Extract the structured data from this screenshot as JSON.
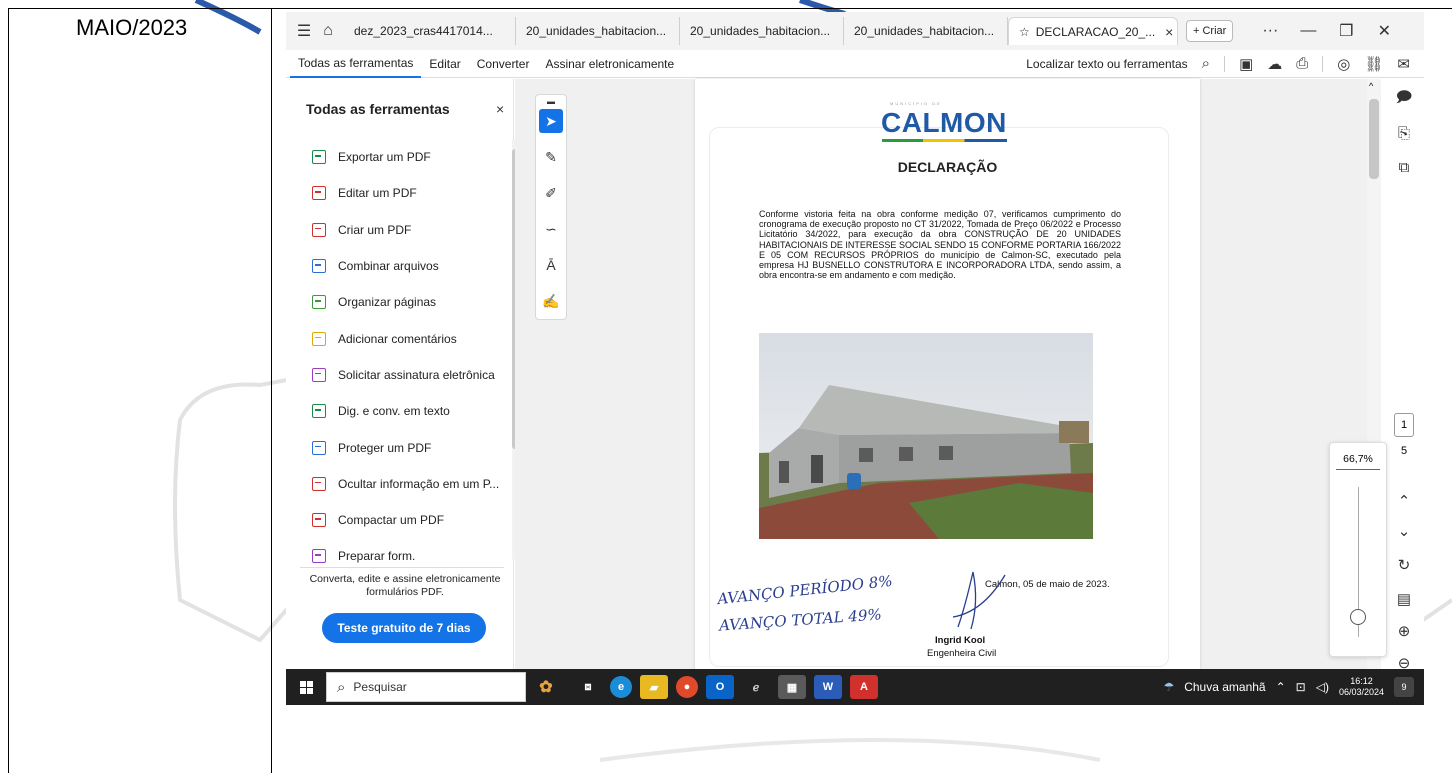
{
  "document": {
    "date_heading": "MAIO/2023"
  },
  "browser": {
    "tabs": [
      {
        "label": "dez_2023_cras4417014..."
      },
      {
        "label": "20_unidades_habitacion..."
      },
      {
        "label": "20_unidades_habitacion..."
      },
      {
        "label": "20_unidades_habitacion..."
      },
      {
        "label": "DECLARACAO_20_..."
      }
    ],
    "criar_label": "+ Criar",
    "more_label": "···"
  },
  "menu": {
    "items": [
      "Todas as ferramentas",
      "Editar",
      "Converter",
      "Assinar eletronicamente"
    ],
    "search_label": "Localizar texto ou ferramentas"
  },
  "tools_panel": {
    "title": "Todas as ferramentas",
    "items": [
      {
        "label": "Exportar um PDF",
        "icon": "export-pdf-icon",
        "color": "#1a8a4a"
      },
      {
        "label": "Editar um PDF",
        "icon": "edit-pdf-icon",
        "color": "#d0312d"
      },
      {
        "label": "Criar um PDF",
        "icon": "create-pdf-icon",
        "color": "#d0312d"
      },
      {
        "label": "Combinar arquivos",
        "icon": "combine-files-icon",
        "color": "#2b6fd6"
      },
      {
        "label": "Organizar páginas",
        "icon": "organize-pages-icon",
        "color": "#3a9a3a"
      },
      {
        "label": "Adicionar comentários",
        "icon": "comment-icon",
        "color": "#e0a800"
      },
      {
        "label": "Solicitar assinatura eletrônica",
        "icon": "request-signature-icon",
        "color": "#9b3cc4"
      },
      {
        "label": "Dig. e conv. em texto",
        "icon": "ocr-icon",
        "color": "#1a8a4a"
      },
      {
        "label": "Proteger um PDF",
        "icon": "protect-pdf-icon",
        "color": "#2b6fd6"
      },
      {
        "label": "Ocultar informação em um P...",
        "icon": "redact-icon",
        "color": "#d0312d"
      },
      {
        "label": "Compactar um PDF",
        "icon": "compress-pdf-icon",
        "color": "#d0312d"
      },
      {
        "label": "Preparar form.",
        "icon": "prepare-form-icon",
        "color": "#9b3cc4"
      }
    ],
    "promo_text": "Converta, edite e assine eletronicamente formulários PDF.",
    "trial_button": "Teste gratuito de 7 dias"
  },
  "pdf_page": {
    "logo_top": "MUNICÍPIO DE",
    "logo": "CALMON",
    "title": "DECLARAÇÃO",
    "body": "Conforme vistoria feita na obra conforme medição 07, verificamos cumprimento do cronograma de execução proposto no CT 31/2022, Tomada de Preço 06/2022 e Processo Licitatório 34/2022, para execução da obra CONSTRUÇÃO DE 20 UNIDADES HABITACIONAIS DE INTERESSE SOCIAL SENDO 15 CONFORME PORTARIA 166/2022 E 05 COM RECURSOS PRÓPRIOS do município de Calmon-SC, executado pela empresa HJ BUSNELLO CONSTRUTORA E INCORPORADORA LTDA, sendo assim, a obra encontra-se em andamento e com medição.",
    "place_date": "Calmon, 05 de maio de 2023.",
    "handwriting_1": "AVANÇO PERÍODO 8%",
    "handwriting_2": "AVANÇO TOTAL 49%",
    "signer_name": "Ingrid Kool",
    "signer_role": "Engenheira Civil"
  },
  "page_nav": {
    "current_page": "1",
    "total_pages": "5"
  },
  "zoom": {
    "value": "66,7%"
  },
  "taskbar": {
    "search_placeholder": "Pesquisar",
    "weather": "Chuva amanhã",
    "time": "16:12",
    "date": "06/03/2024",
    "notifications": "9"
  }
}
